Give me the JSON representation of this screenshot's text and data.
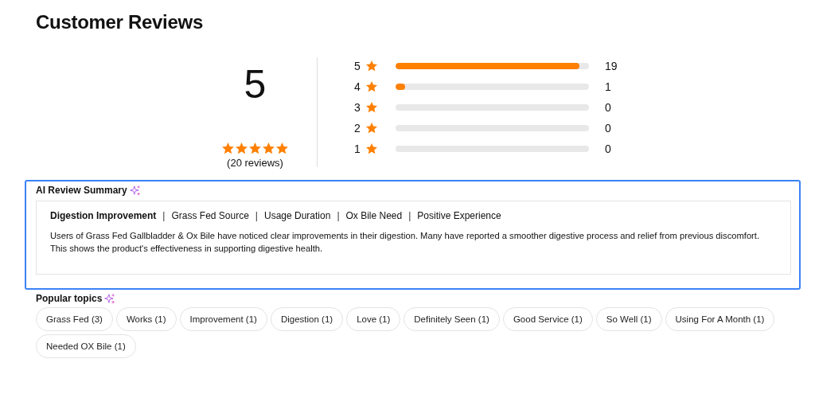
{
  "title": "Customer Reviews",
  "rating": {
    "score": "5",
    "stars": 5,
    "count": "(20 reviews)"
  },
  "distribution": [
    {
      "label": "5",
      "level": 0.95,
      "count": "19"
    },
    {
      "label": "4",
      "level": 0.05,
      "count": "1"
    },
    {
      "label": "3",
      "count": "0"
    },
    {
      "label": "2",
      "count": "0"
    },
    {
      "label": "1",
      "count": "0"
    }
  ],
  "summary": {
    "heading": "AI Review Summary",
    "topics": [
      {
        "label": "Digestion Improvement",
        "selected": true
      },
      {
        "label": "Grass Fed Source",
        "selected": false
      },
      {
        "label": "Usage Duration",
        "selected": false
      },
      {
        "label": "Ox Bile Need",
        "selected": false
      },
      {
        "label": "Positive Experience",
        "selected": false
      }
    ],
    "separator": "|",
    "text": "Users of Grass Fed Gallbladder & Ox Bile have noticed clear improvements in their digestion. Many have reported a smoother digestive process and relief from previous discomfort. This shows the product's effectiveness in supporting digestive health."
  },
  "popular": {
    "heading": "Popular topics",
    "topics": [
      "Grass Fed (3)",
      "Works (1)",
      "Improvement (1)",
      "Digestion (1)",
      "Love (1)",
      "Definitely Seen (1)",
      "Good Service (1)",
      "So Well (1)",
      "Using For A Month (1)",
      "Needed OX Bile (1)"
    ]
  }
}
